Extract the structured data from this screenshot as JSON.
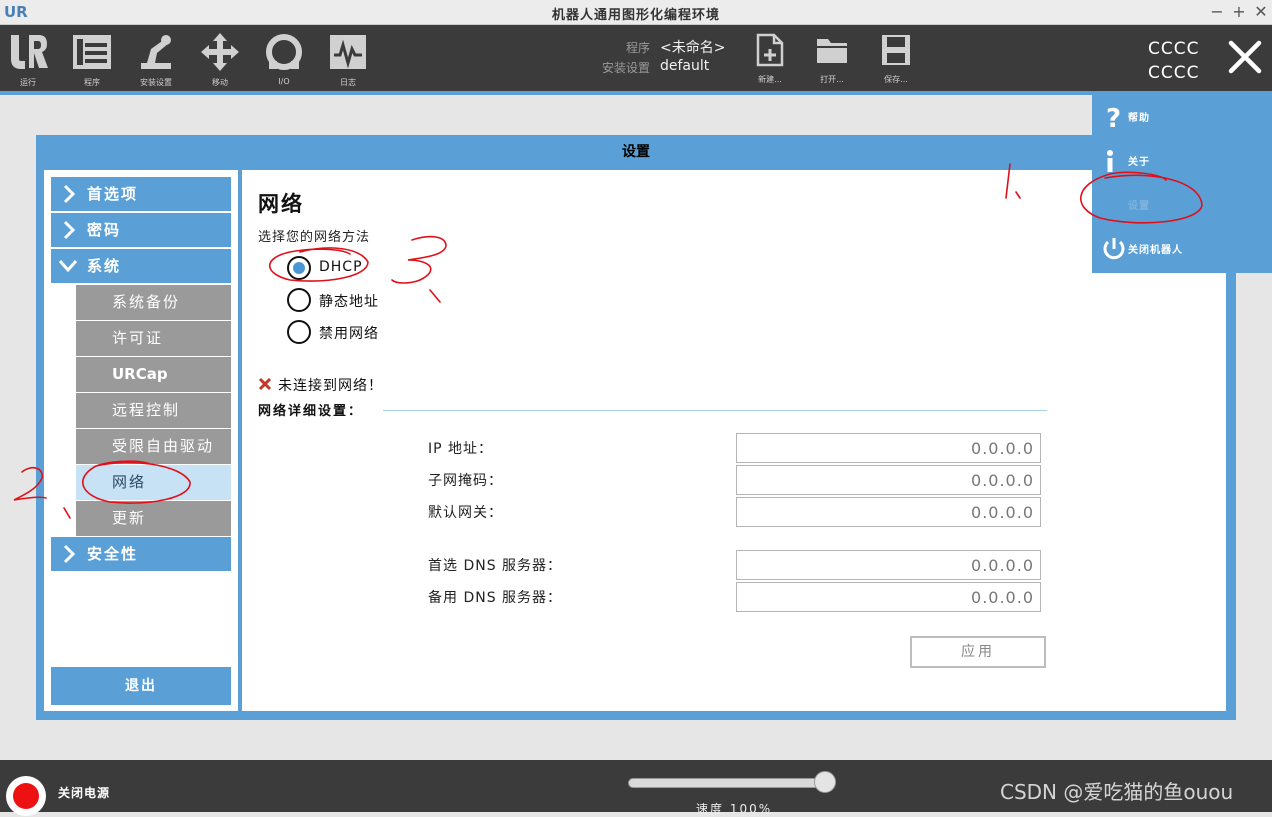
{
  "window": {
    "title": "机器人通用图形化编程环境",
    "logo": "UR",
    "controls": [
      "−",
      "+",
      "✕"
    ]
  },
  "toolbar": {
    "items": [
      {
        "label": "运行",
        "icon": "ur-logo-icon"
      },
      {
        "label": "程序",
        "icon": "program-icon"
      },
      {
        "label": "安装设置",
        "icon": "installation-icon"
      },
      {
        "label": "移动",
        "icon": "move-icon"
      },
      {
        "label": "I/O",
        "icon": "io-icon"
      },
      {
        "label": "日志",
        "icon": "log-icon"
      }
    ],
    "program_key": "程序",
    "program_value": "<未命名>",
    "install_key": "安装设置",
    "install_value": "default",
    "new_label": "新建...",
    "open_label": "打开...",
    "save_label": "保存...",
    "robot_name_line1": "CCCC",
    "robot_name_line2": "CCCC"
  },
  "menu": {
    "help": "帮助",
    "about": "关于",
    "settings": "设置",
    "shutdown": "关闭机器人"
  },
  "dialog": {
    "title": "设置",
    "sidebar": {
      "preferences": "首选项",
      "password": "密码",
      "system": "系统",
      "sub_items": [
        "系统备份",
        "许可证",
        "URCap",
        "远程控制",
        "受限自由驱动",
        "网络",
        "更新"
      ],
      "active_sub": "网络",
      "security": "安全性",
      "exit": "退出"
    },
    "content": {
      "title": "网络",
      "method_label": "选择您的网络方法",
      "options": [
        "DHCP",
        "静态地址",
        "禁用网络"
      ],
      "selected": "DHCP",
      "warning": "未连接到网络！",
      "details_label": "网络详细设置：",
      "fields": [
        {
          "label": "IP 地址：",
          "value": "0.0.0.0"
        },
        {
          "label": "子网掩码：",
          "value": "0.0.0.0"
        },
        {
          "label": "默认网关：",
          "value": "0.0.0.0"
        },
        {
          "label": "首选 DNS 服务器：",
          "value": "0.0.0.0"
        },
        {
          "label": "备用 DNS 服务器：",
          "value": "0.0.0.0"
        }
      ],
      "apply": "应用"
    }
  },
  "bottom": {
    "power_label": "关闭电源",
    "speed_label": "速度 100%",
    "speed_percent": 100,
    "watermark": "CSDN @爱吃猫的鱼ouou"
  },
  "colors": {
    "accent": "#5aa0d6",
    "toolbar": "#3b3b3b",
    "annotation": "#e0101a",
    "power": "#ee1111"
  },
  "annotations": [
    "1、",
    "2、",
    "3、"
  ]
}
